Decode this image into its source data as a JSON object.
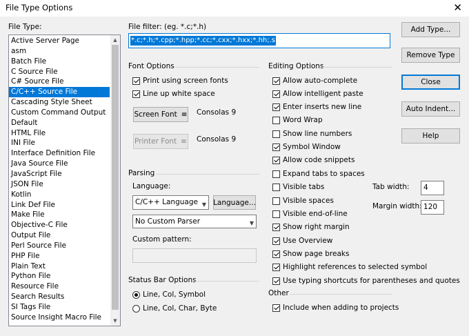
{
  "window": {
    "title": "File Type Options",
    "close_glyph": "✕"
  },
  "file_type": {
    "label": "File Type:",
    "items": [
      "Active Server Page",
      "asm",
      "Batch File",
      "C Source File",
      "C# Source File",
      "C/C++ Source File",
      "Cascading Style Sheet",
      "Custom Command Output",
      "Default",
      "HTML File",
      "INI File",
      "Interface Definition File",
      "Java Source File",
      "JavaScript File",
      "JSON File",
      "Kotlin",
      "Link Def File",
      "Make File",
      "Objective-C File",
      "Output File",
      "Perl Source File",
      "PHP File",
      "Plain Text",
      "Python File",
      "Resource File",
      "Search Results",
      "SI Tags File",
      "Source Insight Macro File"
    ],
    "selected_index": 5
  },
  "file_filter": {
    "label": "File filter: (eg. *.c;*.h)",
    "value": "*.c;*.h;*.cpp;*.hpp;*.cc;*.cxx;*.hxx;*.hh;.s"
  },
  "font_options": {
    "title": "Font Options",
    "print_screen_fonts": {
      "label": "Print using screen fonts",
      "checked": true
    },
    "line_up_whitespace": {
      "label": "Line up white space",
      "checked": true
    },
    "screen_font": {
      "button": "Screen Font",
      "icon": "≡",
      "value": "Consolas 9"
    },
    "printer_font": {
      "button": "Printer Font",
      "icon": "≡",
      "value": "Consolas 9"
    }
  },
  "parsing": {
    "title": "Parsing",
    "language_label": "Language:",
    "language_value": "C/C++ Language",
    "language_button": "Language...",
    "parser_value": "No Custom Parser",
    "custom_pattern_label": "Custom pattern:",
    "custom_pattern_value": ""
  },
  "status_bar": {
    "title": "Status Bar Options",
    "options": [
      {
        "label": "Line, Col, Symbol",
        "selected": true
      },
      {
        "label": "Line, Col, Char, Byte",
        "selected": false
      }
    ]
  },
  "editing": {
    "title": "Editing Options",
    "options": [
      {
        "label": "Allow auto-complete",
        "checked": true
      },
      {
        "label": "Allow intelligent paste",
        "checked": true
      },
      {
        "label": "Enter inserts new line",
        "checked": true
      },
      {
        "label": "Word Wrap",
        "checked": false
      },
      {
        "label": "Show line numbers",
        "checked": false
      },
      {
        "label": "Symbol Window",
        "checked": true
      },
      {
        "label": "Allow code snippets",
        "checked": true
      },
      {
        "label": "Expand tabs to spaces",
        "checked": false
      },
      {
        "label": "Visible tabs",
        "checked": false
      },
      {
        "label": "Visible spaces",
        "checked": false
      },
      {
        "label": "Visible end-of-line",
        "checked": false
      },
      {
        "label": "Show right margin",
        "checked": true
      },
      {
        "label": "Use Overview",
        "checked": true
      },
      {
        "label": "Show page breaks",
        "checked": true
      },
      {
        "label": "Highlight references to selected symbol",
        "checked": true
      },
      {
        "label": "Use typing shortcuts for parentheses and quotes",
        "checked": true
      }
    ],
    "tab_width": {
      "label": "Tab width:",
      "value": "4"
    },
    "margin_width": {
      "label": "Margin width:",
      "value": "120"
    }
  },
  "other": {
    "title": "Other",
    "include_projects": {
      "label": "Include when adding to projects",
      "checked": true
    }
  },
  "buttons": {
    "add_type": "Add Type...",
    "remove_type": "Remove Type",
    "close": "Close",
    "auto_indent": "Auto Indent...",
    "help": "Help"
  },
  "colors": {
    "accent": "#0078d7",
    "selection_text": "#ffffff"
  }
}
